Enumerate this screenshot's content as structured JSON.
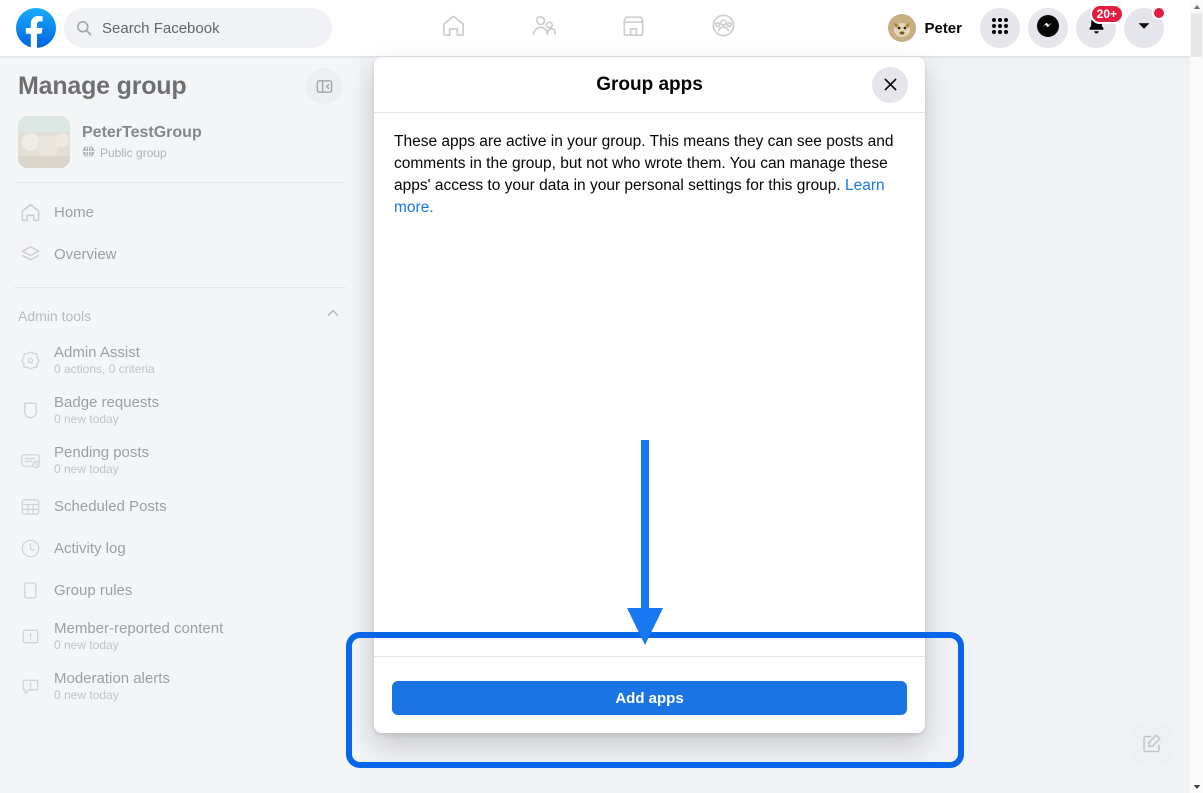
{
  "topbar": {
    "logo_icon": "facebook-logo-icon",
    "search": {
      "icon": "search-icon",
      "value": "",
      "placeholder": "Search Facebook"
    },
    "center_nav": [
      {
        "icon": "home-icon",
        "name": "nav-home"
      },
      {
        "icon": "friends-icon",
        "name": "nav-friends"
      },
      {
        "icon": "marketplace-icon",
        "name": "nav-marketplace"
      },
      {
        "icon": "groups-icon",
        "name": "nav-groups"
      }
    ],
    "profile": {
      "name": "Peter",
      "avatar_icon": "user-avatar"
    },
    "actions": [
      {
        "icon": "menu-grid-icon",
        "name": "menu-button",
        "badge": ""
      },
      {
        "icon": "messenger-icon",
        "name": "messenger-button",
        "badge": ""
      },
      {
        "icon": "bell-icon",
        "name": "notifications-button",
        "badge": "20+"
      },
      {
        "icon": "chevron-down-icon",
        "name": "account-button",
        "badge": "dot"
      }
    ]
  },
  "sidebar": {
    "title": "Manage group",
    "collapse_icon": "panel-collapse-icon",
    "group": {
      "name": "PeterTestGroup",
      "privacy": "Public group",
      "privacy_icon": "globe-icon"
    },
    "top_items": [
      {
        "label": "Home",
        "icon": "home-outline-icon",
        "name": "sidebar-item-home"
      },
      {
        "label": "Overview",
        "icon": "layers-icon",
        "name": "sidebar-item-overview"
      }
    ],
    "section": {
      "label": "Admin tools",
      "chevron_icon": "chevron-up-icon"
    },
    "admin_items": [
      {
        "label": "Admin Assist",
        "sub": "0 actions, 0 criteria",
        "icon": "admin-assist-icon",
        "name": "sidebar-item-admin-assist"
      },
      {
        "label": "Badge requests",
        "sub": "0 new today",
        "icon": "badge-icon",
        "name": "sidebar-item-badge-requests"
      },
      {
        "label": "Pending posts",
        "sub": "0 new today",
        "icon": "pending-posts-icon",
        "name": "sidebar-item-pending-posts"
      },
      {
        "label": "Scheduled Posts",
        "sub": "",
        "icon": "calendar-icon",
        "name": "sidebar-item-scheduled-posts"
      },
      {
        "label": "Activity log",
        "sub": "",
        "icon": "clock-icon",
        "name": "sidebar-item-activity-log"
      },
      {
        "label": "Group rules",
        "sub": "",
        "icon": "book-icon",
        "name": "sidebar-item-group-rules"
      },
      {
        "label": "Member-reported content",
        "sub": "0 new today",
        "icon": "alert-icon",
        "name": "sidebar-item-member-reported-content"
      },
      {
        "label": "Moderation alerts",
        "sub": "0 new today",
        "icon": "moderation-icon",
        "name": "sidebar-item-moderation-alerts"
      }
    ]
  },
  "modal": {
    "title": "Group apps",
    "close_icon": "close-icon",
    "description": "These apps are active in your group. This means they can see posts and comments in the group, but not who wrote them. You can manage these apps' access to your data in your personal settings for this group. ",
    "learn_more": "Learn more.",
    "primary_button": "Add apps"
  },
  "annotations": {
    "highlight_color": "#0a66e8",
    "arrow_color": "#1877f2",
    "arrow_direction": "down"
  },
  "misc": {
    "compose_icon": "compose-icon",
    "scroll_up_icon": "scroll-up-arrow-icon",
    "scroll_down_icon": "scroll-down-arrow-icon"
  },
  "colors": {
    "brand_blue": "#1877f2",
    "button_blue": "#1b74e4",
    "badge_red": "#e41e3f",
    "page_bg": "#f0f2f5"
  }
}
